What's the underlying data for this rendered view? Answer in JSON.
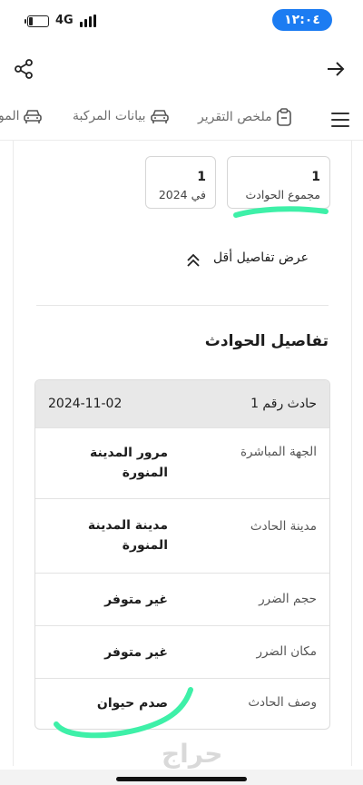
{
  "status_bar": {
    "time": "١٢:٠٤",
    "network": "4G",
    "time_pill_color": "#1c7cf2"
  },
  "top_bar": {
    "left_icon": "share-icon",
    "right_icon": "arrow-right-icon"
  },
  "tabs": [
    {
      "label": "ملخص التقرير",
      "icon": "clipboard-icon"
    },
    {
      "label": "بيانات المركبة",
      "icon": "car-icon"
    },
    {
      "label": "المو",
      "icon": "car-icon"
    }
  ],
  "stats": [
    {
      "value": "1",
      "label": "مجموع الحوادث"
    },
    {
      "value": "1",
      "label": "في 2024"
    }
  ],
  "toggle": {
    "label": "عرض تفاصيل أقل",
    "icon": "chevrons-up-icon"
  },
  "section": {
    "title": "تفاصيل الحوادث"
  },
  "incident": {
    "number_label": "حادث رقم 1",
    "date": "2024-11-02",
    "rows": [
      {
        "key": "الجهة المباشرة",
        "value": "مرور المدينة المنورة"
      },
      {
        "key": "مدينة الحادث",
        "value": "مدينة المدينة المنورة"
      },
      {
        "key": "حجم الضرر",
        "value": "غير متوفر"
      },
      {
        "key": "مكان الضرر",
        "value": "غير متوفر"
      },
      {
        "key": "وصف الحادث",
        "value": "صدم حيوان"
      }
    ]
  },
  "annotation_color": "#3ef0a8",
  "watermark": "حراج"
}
